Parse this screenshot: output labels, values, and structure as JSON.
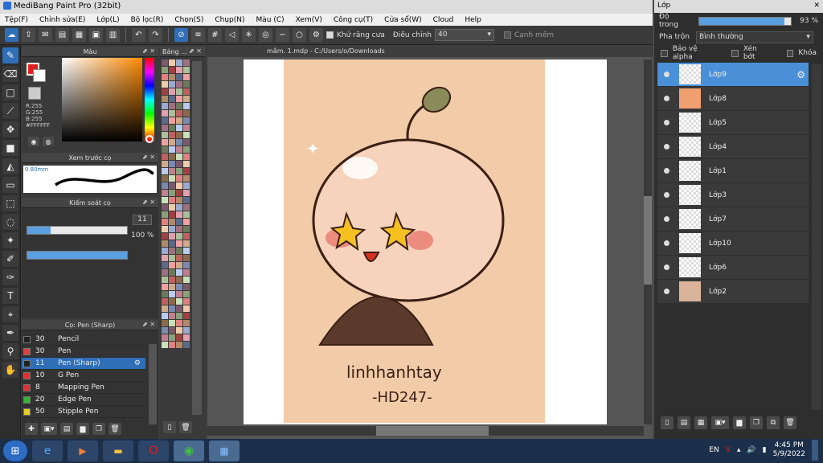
{
  "window": {
    "title": "MediBang Paint Pro (32bit)"
  },
  "menu": [
    "Tệp(F)",
    "Chỉnh sửa(E)",
    "Lớp(L)",
    "Bộ lọc(R)",
    "Chọn(S)",
    "Chụp(N)",
    "Màu (C)",
    "Xem(V)",
    "Công cụ(T)",
    "Cửa sổ(W)",
    "Cloud",
    "Help"
  ],
  "toolbar": {
    "antialias_label": "Khử răng cưa",
    "adjust_label": "Điều chỉnh",
    "adjust_value": "40",
    "edge_label": "Cạnh mềm"
  },
  "color_panel": {
    "title": "Màu",
    "r": "R:255",
    "g": "G:255",
    "b": "B:255",
    "hex": "#FFFFFF",
    "fg": "#e02020",
    "bg": "#ffffff"
  },
  "brush_preview": {
    "title": "Xem trước cọ",
    "size": "0.80mm"
  },
  "brush_control": {
    "title": "Kiểm soát cọ",
    "size_value": "11",
    "size_fraction": 0.23,
    "opacity_value": "100 %",
    "opacity_fraction": 1.0
  },
  "brush_list": {
    "title": "Cọ: Pen (Sharp)",
    "items": [
      {
        "size": "30",
        "name": "Pencil",
        "color": "#222222"
      },
      {
        "size": "30",
        "name": "Pen",
        "color": "#e04040"
      },
      {
        "size": "11",
        "name": "Pen (Sharp)",
        "color": "#222222",
        "selected": true
      },
      {
        "size": "10",
        "name": "G Pen",
        "color": "#e03030"
      },
      {
        "size": "8",
        "name": "Mapping Pen",
        "color": "#e03030"
      },
      {
        "size": "20",
        "name": "Edge Pen",
        "color": "#2eb82e"
      },
      {
        "size": "50",
        "name": "Stipple Pen",
        "color": "#e8d020"
      }
    ]
  },
  "palette": {
    "title": "Bảng ..."
  },
  "document": {
    "tab": "mầm. 1.mdp - C:/Users/o/Downloads"
  },
  "artwork": {
    "line1": "linhhanhtay",
    "line2": "-HD247-"
  },
  "layers": {
    "title": "Lớp",
    "opacity_label": "Độ trong",
    "opacity_value": "93 %",
    "opacity_fraction": 0.93,
    "blend_label": "Pha trộn",
    "blend_value": "Bình thường",
    "protect_alpha": "Bảo vệ alpha",
    "clipping": "Xén bớt",
    "lock": "Khóa",
    "items": [
      {
        "name": "Lớp9",
        "selected": true
      },
      {
        "name": "Lớp8",
        "fill": "#f0a070"
      },
      {
        "name": "Lớp5"
      },
      {
        "name": "Lớp4"
      },
      {
        "name": "Lớp1"
      },
      {
        "name": "Lớp3"
      },
      {
        "name": "Lớp7"
      },
      {
        "name": "Lớp10"
      },
      {
        "name": "Lớp6"
      },
      {
        "name": "Lớp2",
        "fill": "#d9b49a"
      }
    ]
  },
  "taskbar": {
    "lang": "EN",
    "time": "4:45 PM",
    "date": "5/9/2022"
  }
}
